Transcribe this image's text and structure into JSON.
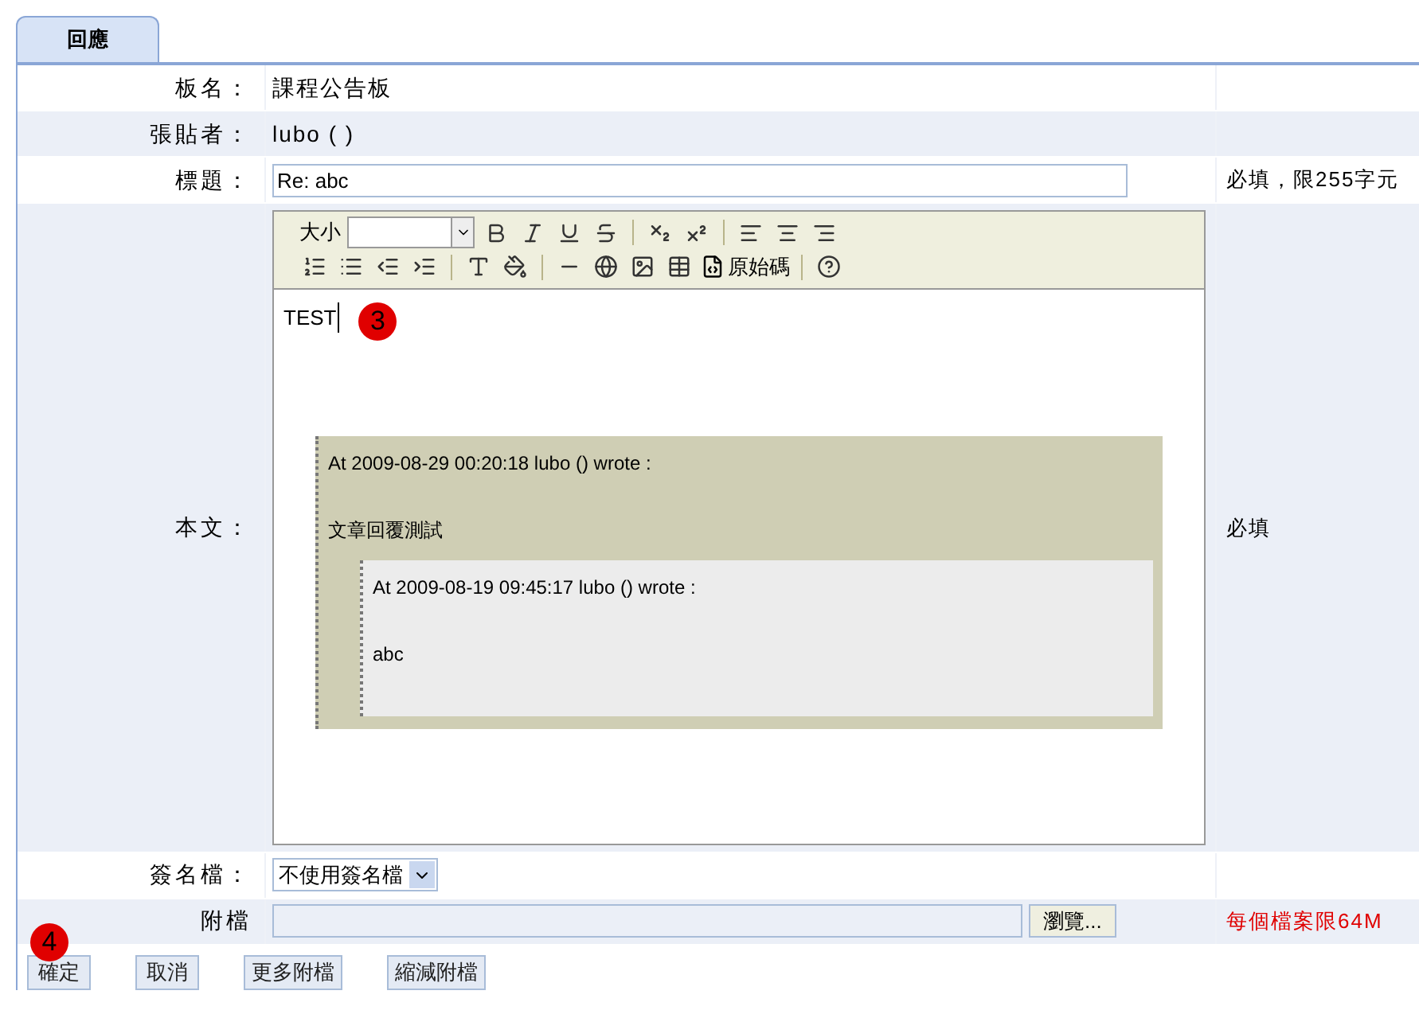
{
  "tab": {
    "label": "回應",
    "selected": true
  },
  "fields": [
    {
      "kind": "text",
      "label": "板名：",
      "value": "課程公告板"
    },
    {
      "kind": "text",
      "label": "張貼者：",
      "value": "lubo ( )"
    },
    {
      "kind": "input",
      "label": "標題：",
      "value": "Re: abc",
      "note": "必填，限255字元"
    },
    {
      "kind": "editor",
      "label": "本文：",
      "note": "必填"
    },
    {
      "kind": "select",
      "label": "簽名檔：",
      "value": "不使用簽名檔"
    },
    {
      "kind": "file",
      "label": "附檔",
      "button": "瀏覽...",
      "note": "每個檔案限64M"
    }
  ],
  "editor": {
    "size_label": "大小",
    "source_label": "原始碼",
    "typed": "TEST",
    "quote": {
      "header": "At 2009-08-29 00:20:18 lubo () wrote :",
      "body": "文章回覆測試",
      "quote": {
        "header": "At 2009-08-19 09:45:17 lubo () wrote :",
        "body": "abc"
      }
    }
  },
  "buttons": [
    "確定",
    "取消",
    "更多附檔",
    "縮減附檔"
  ],
  "editor_badge": {
    "label": "3"
  },
  "buttons_badge": {
    "label": "4"
  }
}
